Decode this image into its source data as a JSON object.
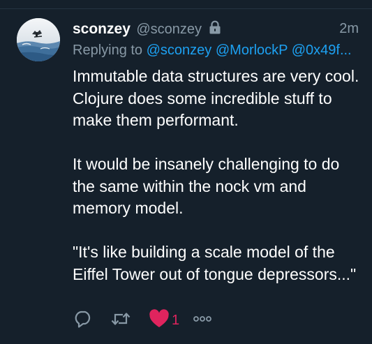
{
  "tweet": {
    "display_name": "sconzey",
    "handle": "@sconzey",
    "timestamp": "2m",
    "protected_icon": "lock-icon",
    "replying_to_label": "Replying to",
    "mentions": [
      "@sconzey",
      "@MorlockP",
      "@0x49f..."
    ],
    "body": "Immutable data structures are very cool. Clojure does some incredible stuff to make them performant.\n\nIt would be insanely challenging to do the same within the nock vm and memory model.\n\n\"It's like building a scale model of the Eiffel Tower out of tongue depressors...\""
  },
  "actions": {
    "reply_icon": "reply-icon",
    "retweet_icon": "retweet-icon",
    "like_icon": "heart-icon",
    "like_count": "1",
    "more_icon": "more-icon"
  },
  "colors": {
    "background": "#15202b",
    "text": "#ffffff",
    "secondary_text": "#8899a6",
    "link": "#1da1f2",
    "like": "#e0245e"
  }
}
